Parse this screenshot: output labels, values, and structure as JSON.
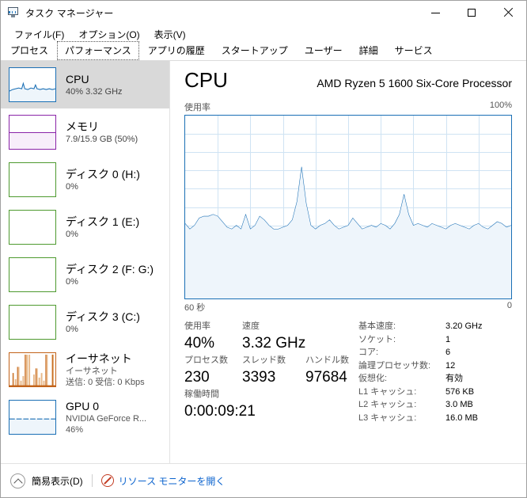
{
  "window": {
    "title": "タスク マネージャー",
    "icon": "task-manager-icon",
    "minimize": "—",
    "maximize": "□",
    "close": "✕"
  },
  "menu": [
    {
      "label": "ファイル(F)"
    },
    {
      "label": "オプション(O)"
    },
    {
      "label": "表示(V)"
    }
  ],
  "tabs": [
    {
      "label": "プロセス",
      "active": false
    },
    {
      "label": "パフォーマンス",
      "active": true
    },
    {
      "label": "アプリの履歴",
      "active": false
    },
    {
      "label": "スタートアップ",
      "active": false
    },
    {
      "label": "ユーザー",
      "active": false
    },
    {
      "label": "詳細",
      "active": false
    },
    {
      "label": "サービス",
      "active": false
    }
  ],
  "sidebar": {
    "items": [
      {
        "name": "cpu",
        "title": "CPU",
        "sub1": "40%  3.32 GHz",
        "sub2": "",
        "sub3": "",
        "selected": true,
        "accent": "#1a6fb5",
        "graph": "line-area"
      },
      {
        "name": "memory",
        "title": "メモリ",
        "sub1": "7.9/15.9 GB (50%)",
        "sub2": "",
        "sub3": "",
        "selected": false,
        "accent": "#8a24a8",
        "graph": "fill-50"
      },
      {
        "name": "disk-0",
        "title": "ディスク 0 (H:)",
        "sub1": "0%",
        "sub2": "",
        "sub3": "",
        "selected": false,
        "accent": "#4e9a2f",
        "graph": "empty"
      },
      {
        "name": "disk-1",
        "title": "ディスク 1 (E:)",
        "sub1": "0%",
        "sub2": "",
        "sub3": "",
        "selected": false,
        "accent": "#4e9a2f",
        "graph": "empty"
      },
      {
        "name": "disk-2",
        "title": "ディスク 2 (F: G:)",
        "sub1": "0%",
        "sub2": "",
        "sub3": "",
        "selected": false,
        "accent": "#4e9a2f",
        "graph": "empty"
      },
      {
        "name": "disk-3",
        "title": "ディスク 3 (C:)",
        "sub1": "0%",
        "sub2": "",
        "sub3": "",
        "selected": false,
        "accent": "#4e9a2f",
        "graph": "empty"
      },
      {
        "name": "ethernet",
        "title": "イーサネット",
        "sub1": "イーサネット",
        "sub2": "送信: 0 受信: 0 Kbps",
        "sub3": "",
        "selected": false,
        "accent": "#c2631a",
        "graph": "spikes"
      },
      {
        "name": "gpu-0",
        "title": "GPU 0",
        "sub1": "NVIDIA GeForce R...",
        "sub2": "46%",
        "sub3": "",
        "selected": false,
        "accent": "#1a6fb5",
        "graph": "flat-46"
      }
    ]
  },
  "main": {
    "title": "CPU",
    "model": "AMD Ryzen 5 1600 Six-Core Processor",
    "graph_top_label": "使用率",
    "graph_max_label": "100%",
    "axis_left": "60 秒",
    "axis_right": "0",
    "stats_left": [
      {
        "label": "使用率",
        "value": "40%"
      },
      {
        "label": "速度",
        "value": "3.32 GHz"
      },
      {
        "label": "プロセス数",
        "value": "230"
      },
      {
        "label": "スレッド数",
        "value": "3393"
      },
      {
        "label": "ハンドル数",
        "value": "97684"
      },
      {
        "label": "稼働時間",
        "value": "0:00:09:21"
      }
    ],
    "specs": [
      {
        "key": "基本速度:",
        "value": "3.20 GHz"
      },
      {
        "key": "ソケット:",
        "value": "1"
      },
      {
        "key": "コア:",
        "value": "6"
      },
      {
        "key": "論理プロセッサ数:",
        "value": "12"
      },
      {
        "key": "仮想化:",
        "value": "有効"
      },
      {
        "key": "L1 キャッシュ:",
        "value": "576 KB"
      },
      {
        "key": "L2 キャッシュ:",
        "value": "3.0 MB"
      },
      {
        "key": "L3 キャッシュ:",
        "value": "16.0 MB"
      }
    ]
  },
  "chart_data": {
    "type": "area",
    "title": "使用率",
    "xlabel": "60 秒",
    "ylabel": "使用率",
    "ylim": [
      0,
      100
    ],
    "xlim": [
      60,
      0
    ],
    "grid": true,
    "line_color": "#1a6fb5",
    "fill_color": "#eef5fb",
    "x": [
      0,
      2,
      4,
      6,
      8,
      10,
      12,
      14,
      16,
      18,
      20,
      22,
      24,
      26,
      28,
      30,
      32,
      34,
      36,
      38,
      40,
      42,
      44,
      46,
      48,
      50,
      52,
      54,
      56,
      58,
      60,
      62,
      64,
      66,
      68,
      70,
      72,
      74,
      76,
      78,
      80,
      82,
      84,
      86,
      88,
      90,
      92,
      94,
      96,
      98,
      100
    ],
    "values": [
      41,
      38,
      40,
      44,
      45,
      45,
      46,
      45,
      42,
      39,
      38,
      40,
      38,
      46,
      38,
      40,
      45,
      43,
      40,
      38,
      38,
      39,
      40,
      43,
      53,
      72,
      52,
      40,
      38,
      40,
      41,
      43,
      40,
      38,
      39,
      40,
      44,
      41,
      38,
      39,
      40,
      39,
      41,
      40,
      38,
      41,
      46,
      57,
      46,
      40,
      41,
      40,
      39,
      41,
      40,
      39,
      38,
      40,
      41,
      40,
      39,
      38,
      40,
      41,
      39,
      38,
      40,
      42,
      41,
      39,
      40
    ]
  },
  "statusbar": {
    "collapse_label": "簡易表示(D)",
    "resource_monitor_label": "リソース モニターを開く",
    "chevron_icon": "chevron-up-icon",
    "resmon_icon": "resource-monitor-icon"
  }
}
